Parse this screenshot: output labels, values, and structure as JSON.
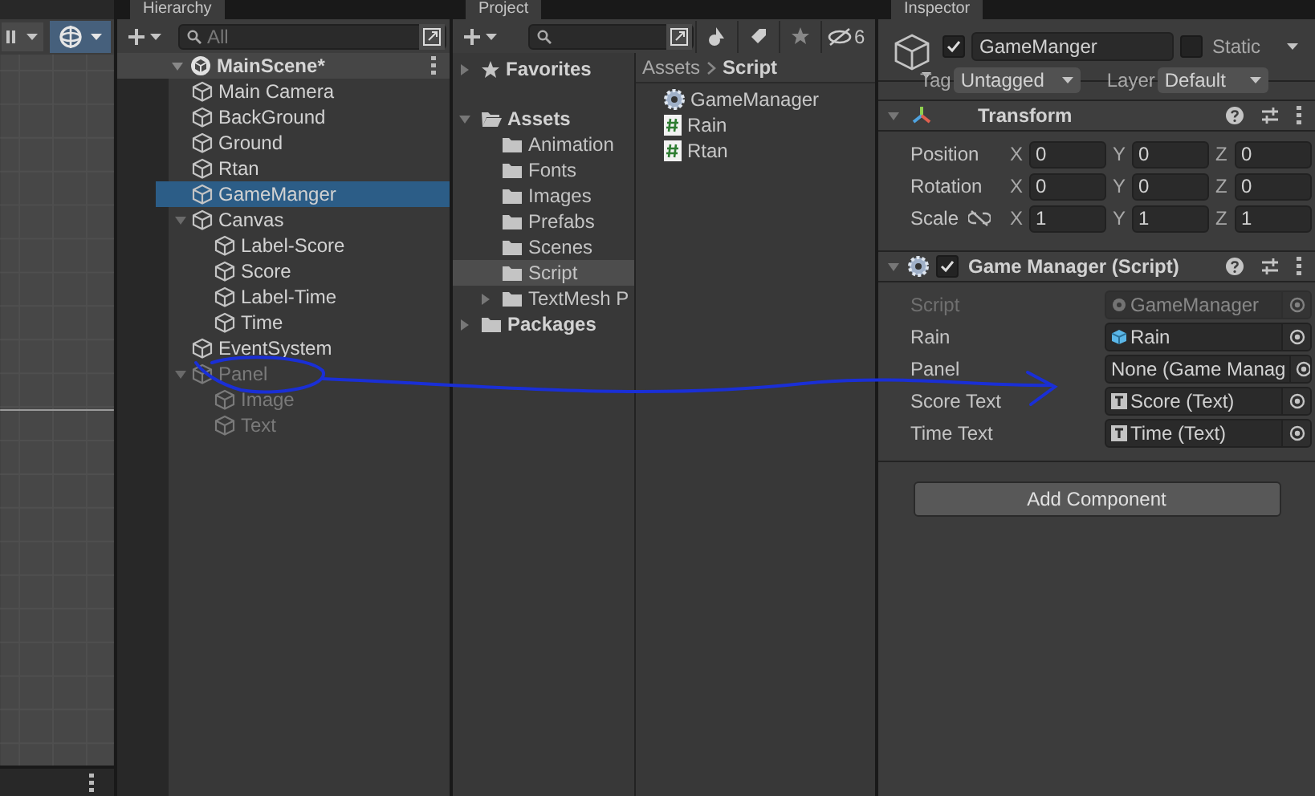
{
  "hierarchy": {
    "tab": "Hierarchy",
    "search": {
      "placeholder": "All"
    },
    "scene": {
      "name": "MainScene*",
      "expanded": true,
      "children": [
        {
          "name": "Main Camera",
          "selected": false,
          "active": true
        },
        {
          "name": "BackGround",
          "selected": false,
          "active": true
        },
        {
          "name": "Ground",
          "selected": false,
          "active": true
        },
        {
          "name": "Rtan",
          "selected": false,
          "active": true
        },
        {
          "name": "GameManger",
          "selected": true,
          "active": true
        },
        {
          "name": "Canvas",
          "selected": false,
          "active": true,
          "expanded": true,
          "children": [
            {
              "name": "Label-Score",
              "selected": false,
              "active": true
            },
            {
              "name": "Score",
              "selected": false,
              "active": true
            },
            {
              "name": "Label-Time",
              "selected": false,
              "active": true
            },
            {
              "name": "Time",
              "selected": false,
              "active": true
            }
          ]
        },
        {
          "name": "EventSystem",
          "selected": false,
          "active": true
        },
        {
          "name": "Panel",
          "selected": false,
          "active": false,
          "expanded": true,
          "children": [
            {
              "name": "Image",
              "selected": false,
              "active": false
            },
            {
              "name": "Text",
              "selected": false,
              "active": false
            }
          ]
        }
      ]
    }
  },
  "project": {
    "tab": "Project",
    "hidden_count": "6",
    "favorites": {
      "label": "Favorites",
      "expanded": false
    },
    "assets": {
      "label": "Assets",
      "expanded": true,
      "children": [
        {
          "label": "Animation",
          "selected": false
        },
        {
          "label": "Fonts",
          "selected": false
        },
        {
          "label": "Images",
          "selected": false
        },
        {
          "label": "Prefabs",
          "selected": false
        },
        {
          "label": "Scenes",
          "selected": false
        },
        {
          "label": "Script",
          "selected": true
        },
        {
          "label": "TextMesh P",
          "selected": false,
          "expandable": true
        }
      ]
    },
    "packages": {
      "label": "Packages",
      "expanded": false
    },
    "breadcrumb": [
      "Assets",
      "Script"
    ],
    "files": [
      {
        "name": "GameManager",
        "kind": "gear"
      },
      {
        "name": "Rain",
        "kind": "script"
      },
      {
        "name": "Rtan",
        "kind": "script"
      }
    ]
  },
  "inspector": {
    "tab": "Inspector",
    "object": {
      "name": "GameManger",
      "active": true,
      "static_label": "Static",
      "static": false,
      "tag_label": "Tag",
      "tag": "Untagged",
      "layer_label": "Layer",
      "layer": "Default"
    },
    "transform": {
      "title": "Transform",
      "expanded": true,
      "rows": [
        {
          "label": "Position",
          "values": [
            {
              "axis": "X",
              "value": "0"
            },
            {
              "axis": "Y",
              "value": "0"
            },
            {
              "axis": "Z",
              "value": "0"
            }
          ]
        },
        {
          "label": "Rotation",
          "values": [
            {
              "axis": "X",
              "value": "0"
            },
            {
              "axis": "Y",
              "value": "0"
            },
            {
              "axis": "Z",
              "value": "0"
            }
          ]
        },
        {
          "label": "Scale",
          "linked": false,
          "values": [
            {
              "axis": "X",
              "value": "1"
            },
            {
              "axis": "Y",
              "value": "1"
            },
            {
              "axis": "Z",
              "value": "1"
            }
          ]
        }
      ]
    },
    "component": {
      "title": "Game Manager (Script)",
      "expanded": true,
      "enabled": true,
      "fields": [
        {
          "label": "Script",
          "value": "GameManager",
          "kind": "script",
          "disabled": true
        },
        {
          "label": "Rain",
          "value": "Rain",
          "kind": "prefab",
          "disabled": false
        },
        {
          "label": "Panel",
          "value": "None (Game Manag",
          "kind": "none",
          "disabled": false
        },
        {
          "label": "Score Text",
          "value": "Score (Text)",
          "kind": "text",
          "disabled": false
        },
        {
          "label": "Time Text",
          "value": "Time (Text)",
          "kind": "text",
          "disabled": false
        }
      ]
    },
    "add_button": "Add Component"
  }
}
